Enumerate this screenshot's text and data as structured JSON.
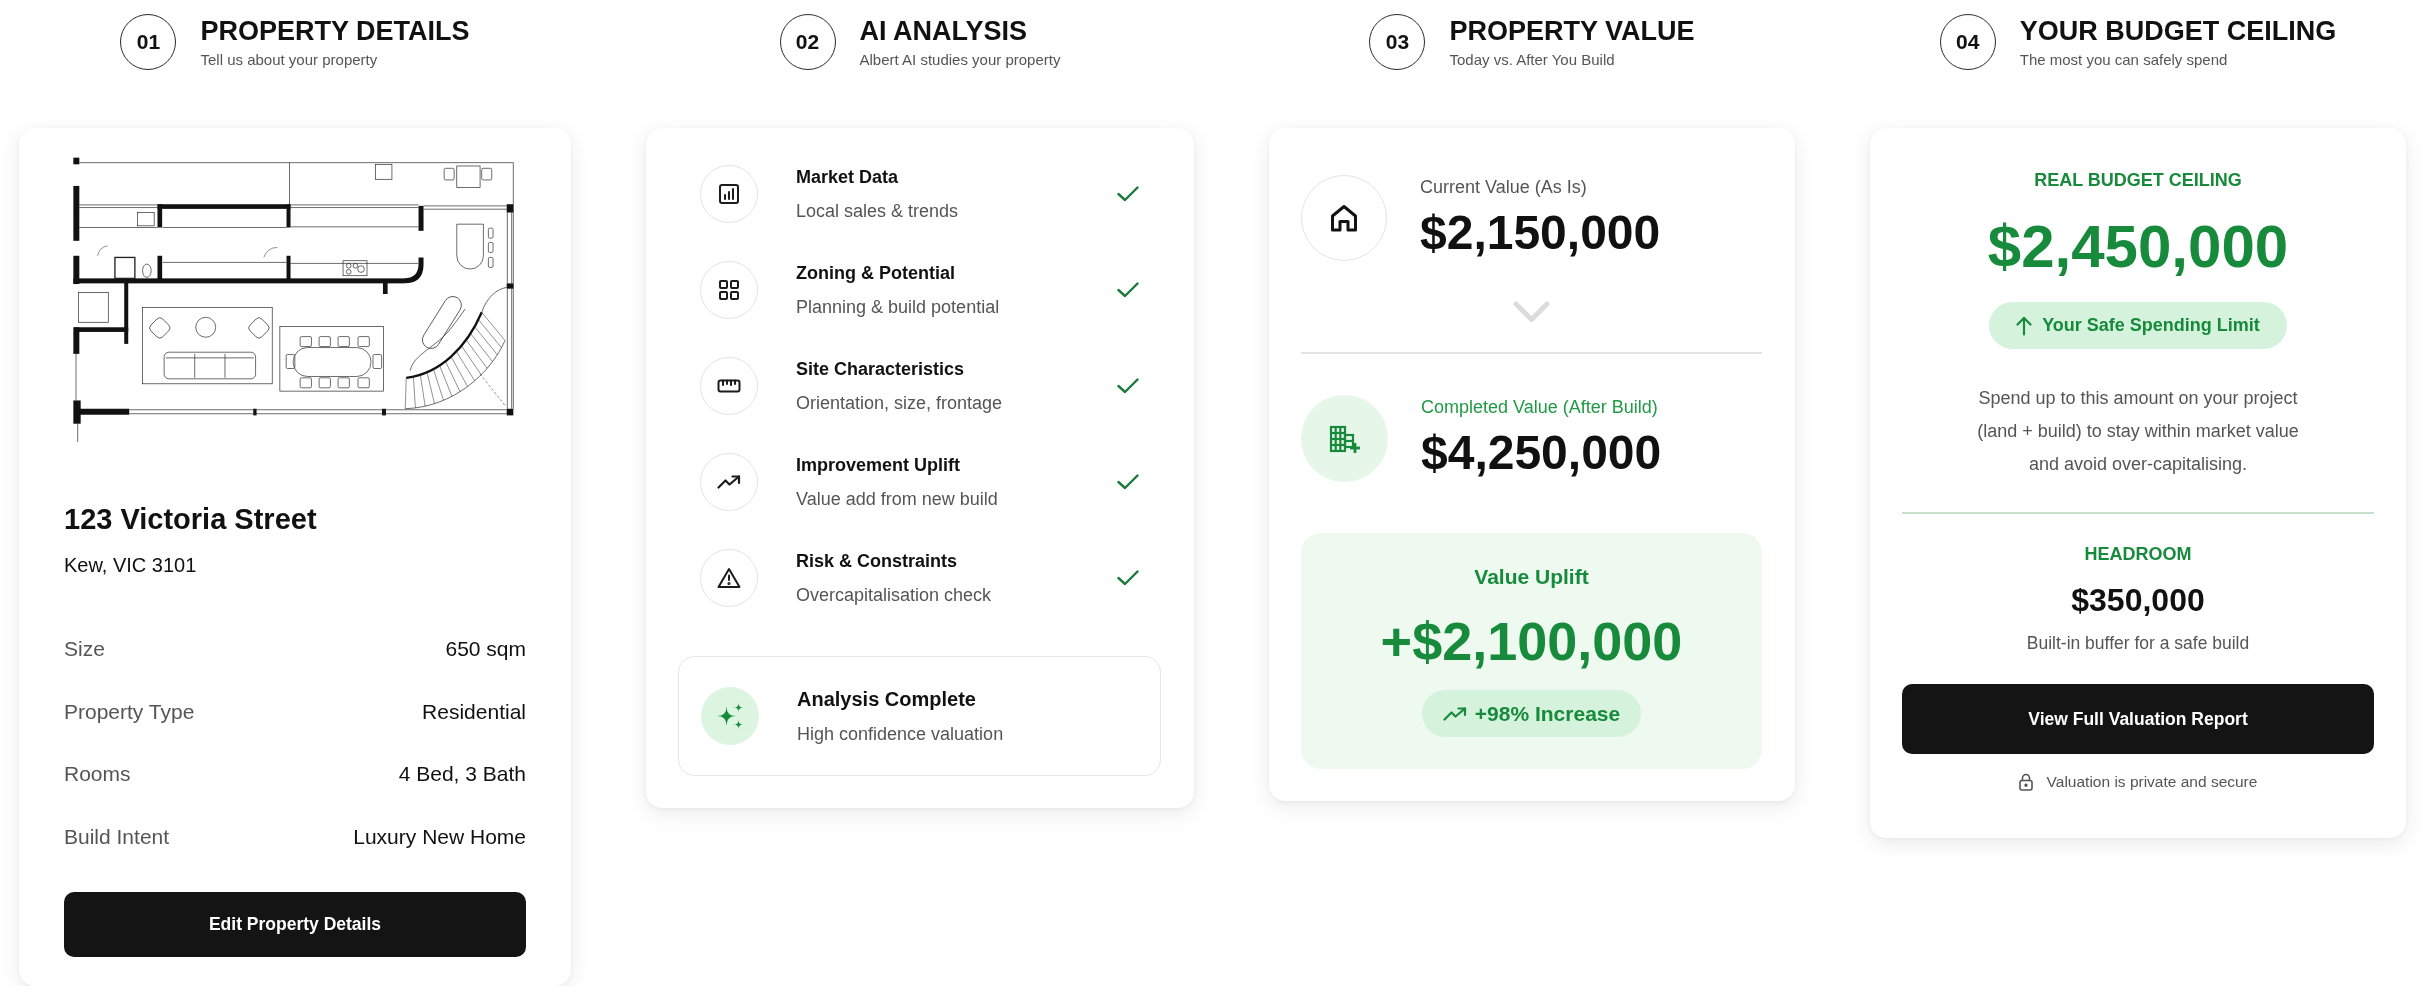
{
  "property_details": {
    "step": {
      "number": "01",
      "title": "PROPERTY DETAILS",
      "subtitle": "Tell us about your property"
    },
    "street": "123 Victoria Street",
    "suburb": "Kew, VIC 3101",
    "facts": [
      {
        "label": "Size",
        "value": "650 sqm"
      },
      {
        "label": "Property Type",
        "value": "Residential"
      },
      {
        "label": "Rooms",
        "value": "4 Bed, 3 Bath"
      },
      {
        "label": "Build Intent",
        "value": "Luxury New Home"
      }
    ],
    "button": "Edit Property Details"
  },
  "ai_analysis": {
    "step": {
      "number": "02",
      "title": "AI ANALYSIS",
      "subtitle": "Albert AI studies your property"
    },
    "items": [
      {
        "title": "Market Data",
        "subtitle": "Local sales & trends",
        "checked": true
      },
      {
        "title": "Zoning & Potential",
        "subtitle": "Planning & build potential",
        "checked": true
      },
      {
        "title": "Site Characteristics",
        "subtitle": "Orientation, size, frontage",
        "checked": true
      },
      {
        "title": "Improvement Uplift",
        "subtitle": "Value add from new build",
        "checked": true
      },
      {
        "title": "Risk & Constraints",
        "subtitle": "Overcapitalisation check",
        "checked": true
      }
    ],
    "summary": {
      "title": "Analysis Complete",
      "subtitle": "High confidence valuation"
    }
  },
  "property_value": {
    "step": {
      "number": "03",
      "title": "PROPERTY VALUE",
      "subtitle": "Today vs. After You Build"
    },
    "current": {
      "label": "Current Value (As Is)",
      "value": "$2,150,000"
    },
    "completed": {
      "label": "Completed Value (After Build)",
      "value": "$4,250,000"
    },
    "uplift": {
      "label": "Value Uplift",
      "value": "+$2,100,000",
      "change": "+98% Increase"
    }
  },
  "budget_ceiling": {
    "step": {
      "number": "04",
      "title": "YOUR BUDGET CEILING",
      "subtitle": "The most you can safely spend"
    },
    "label": "REAL BUDGET CEILING",
    "value": "$2,450,000",
    "limit": "Your Safe Spending Limit",
    "description": "Spend up to this amount on your project (land + build) to stay within market value and avoid over-capitalising.",
    "headroom": {
      "label": "HEADROOM",
      "value": "$350,000",
      "note": "Built-in buffer for a safe build"
    },
    "button": "View Full Valuation Report",
    "privacy_note": "Valuation is private and secure"
  }
}
